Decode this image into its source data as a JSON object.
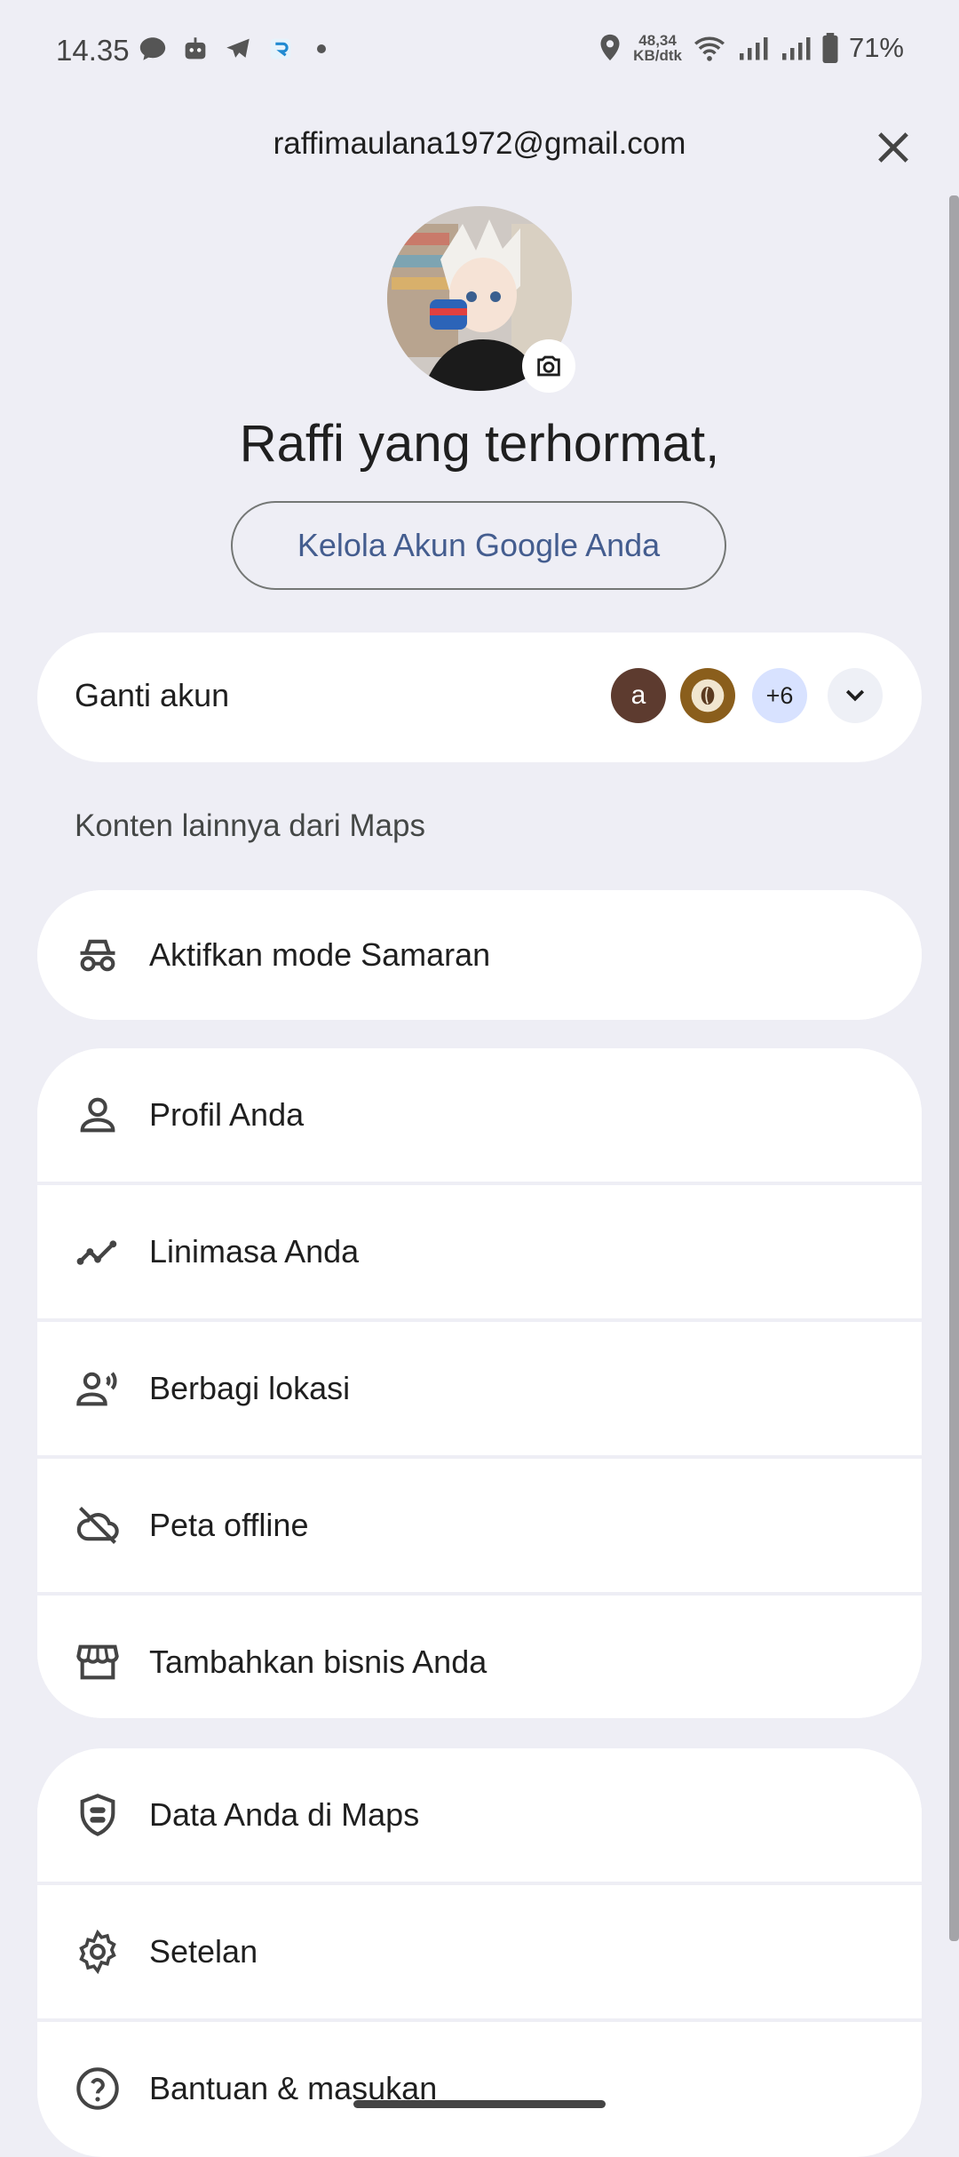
{
  "status_bar": {
    "time": "14.35",
    "speed_value": "48,34",
    "speed_unit": "KB/dtk",
    "battery": "71%"
  },
  "header": {
    "email": "raffimaulana1972@gmail.com",
    "greeting": "Raffi yang terhormat,",
    "manage_button": "Kelola Akun Google Anda"
  },
  "switcher": {
    "label": "Ganti akun",
    "account_initial": "a",
    "more_count": "+6"
  },
  "section_label": "Konten lainnya dari Maps",
  "incognito": {
    "label": "Aktifkan mode Samaran",
    "icon": "incognito-icon"
  },
  "menu_group_1": [
    {
      "label": "Profil Anda",
      "icon": "person-icon"
    },
    {
      "label": "Linimasa Anda",
      "icon": "timeline-icon"
    },
    {
      "label": "Berbagi lokasi",
      "icon": "location-sharing-icon"
    },
    {
      "label": "Peta offline",
      "icon": "offline-cloud-icon"
    },
    {
      "label": "Tambahkan bisnis Anda",
      "icon": "storefront-icon"
    }
  ],
  "menu_group_2": [
    {
      "label": "Data Anda di Maps",
      "icon": "privacy-shield-icon"
    },
    {
      "label": "Setelan",
      "icon": "gear-icon"
    },
    {
      "label": "Bantuan & masukan",
      "icon": "help-icon"
    }
  ],
  "colors": {
    "background": "#eeeef5",
    "card": "#ffffff",
    "link": "#445d8f",
    "chip_more": "#d8e2ff"
  }
}
